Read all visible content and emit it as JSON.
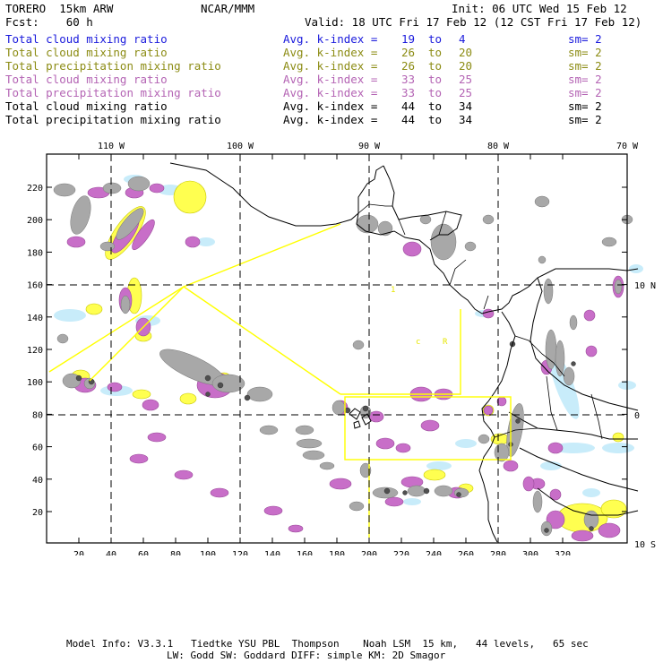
{
  "header": {
    "model": "TORERO  15km ARW",
    "org": "NCAR/MMM",
    "init": "Init: 06 UTC Wed 15 Feb 12",
    "fcst": "Fcst:    60 h",
    "valid": "Valid: 18 UTC Fri 17 Feb 12 (12 CST Fri 17 Feb 12)"
  },
  "legend": [
    {
      "field": "Total cloud mixing ratio",
      "index_label": "Avg. k-index =",
      "from": "19",
      "to_word": "to",
      "to": "4",
      "sm": "sm= 2",
      "color": "#1a1adc"
    },
    {
      "field": "Total cloud mixing ratio",
      "index_label": "Avg. k-index =",
      "from": "26",
      "to_word": "to",
      "to": "20",
      "sm": "sm= 2",
      "color": "#8c8c14"
    },
    {
      "field": "Total precipitation mixing ratio",
      "index_label": "Avg. k-index =",
      "from": "26",
      "to_word": "to",
      "to": "20",
      "sm": "sm= 2",
      "color": "#8c8c14"
    },
    {
      "field": "Total cloud mixing ratio",
      "index_label": "Avg. k-index =",
      "from": "33",
      "to_word": "to",
      "to": "25",
      "sm": "sm= 2",
      "color": "#b464b4"
    },
    {
      "field": "Total precipitation mixing ratio",
      "index_label": "Avg. k-index =",
      "from": "33",
      "to_word": "to",
      "to": "25",
      "sm": "sm= 2",
      "color": "#b464b4"
    },
    {
      "field": "Total cloud mixing ratio",
      "index_label": "Avg. k-index =",
      "from": "44",
      "to_word": "to",
      "to": "34",
      "sm": "sm= 2",
      "color": "#000000"
    },
    {
      "field": "Total precipitation mixing ratio",
      "index_label": "Avg. k-index =",
      "from": "44",
      "to_word": "to",
      "to": "34",
      "sm": "sm= 2",
      "color": "#000000"
    }
  ],
  "map": {
    "x_ticks": [
      "20",
      "40",
      "60",
      "80",
      "100",
      "120",
      "140",
      "160",
      "180",
      "200",
      "220",
      "240",
      "260",
      "280",
      "300",
      "320"
    ],
    "y_ticks": [
      "20",
      "40",
      "60",
      "80",
      "100",
      "120",
      "140",
      "160",
      "180",
      "200",
      "220"
    ],
    "lon_labels": [
      "110 W",
      "100 W",
      "90 W",
      "80 W",
      "70 W"
    ],
    "lat_labels": [
      "10 N",
      "0",
      "10 S"
    ],
    "colors": {
      "light_blue": "#c8ecfa",
      "yellow": "#ffff50",
      "purple": "#c86ec8",
      "gray": "#a8a8a8",
      "dark": "#505050",
      "coast": "#000000",
      "box": "#ffff00"
    }
  },
  "footer": {
    "line1": "Model Info: V3.3.1   Tiedtke YSU PBL  Thompson    Noah LSM  15 km,   44 levels,   65 sec",
    "line2": "LW: Godd SW: Goddard DIFF: simple KM: 2D Smagor"
  }
}
